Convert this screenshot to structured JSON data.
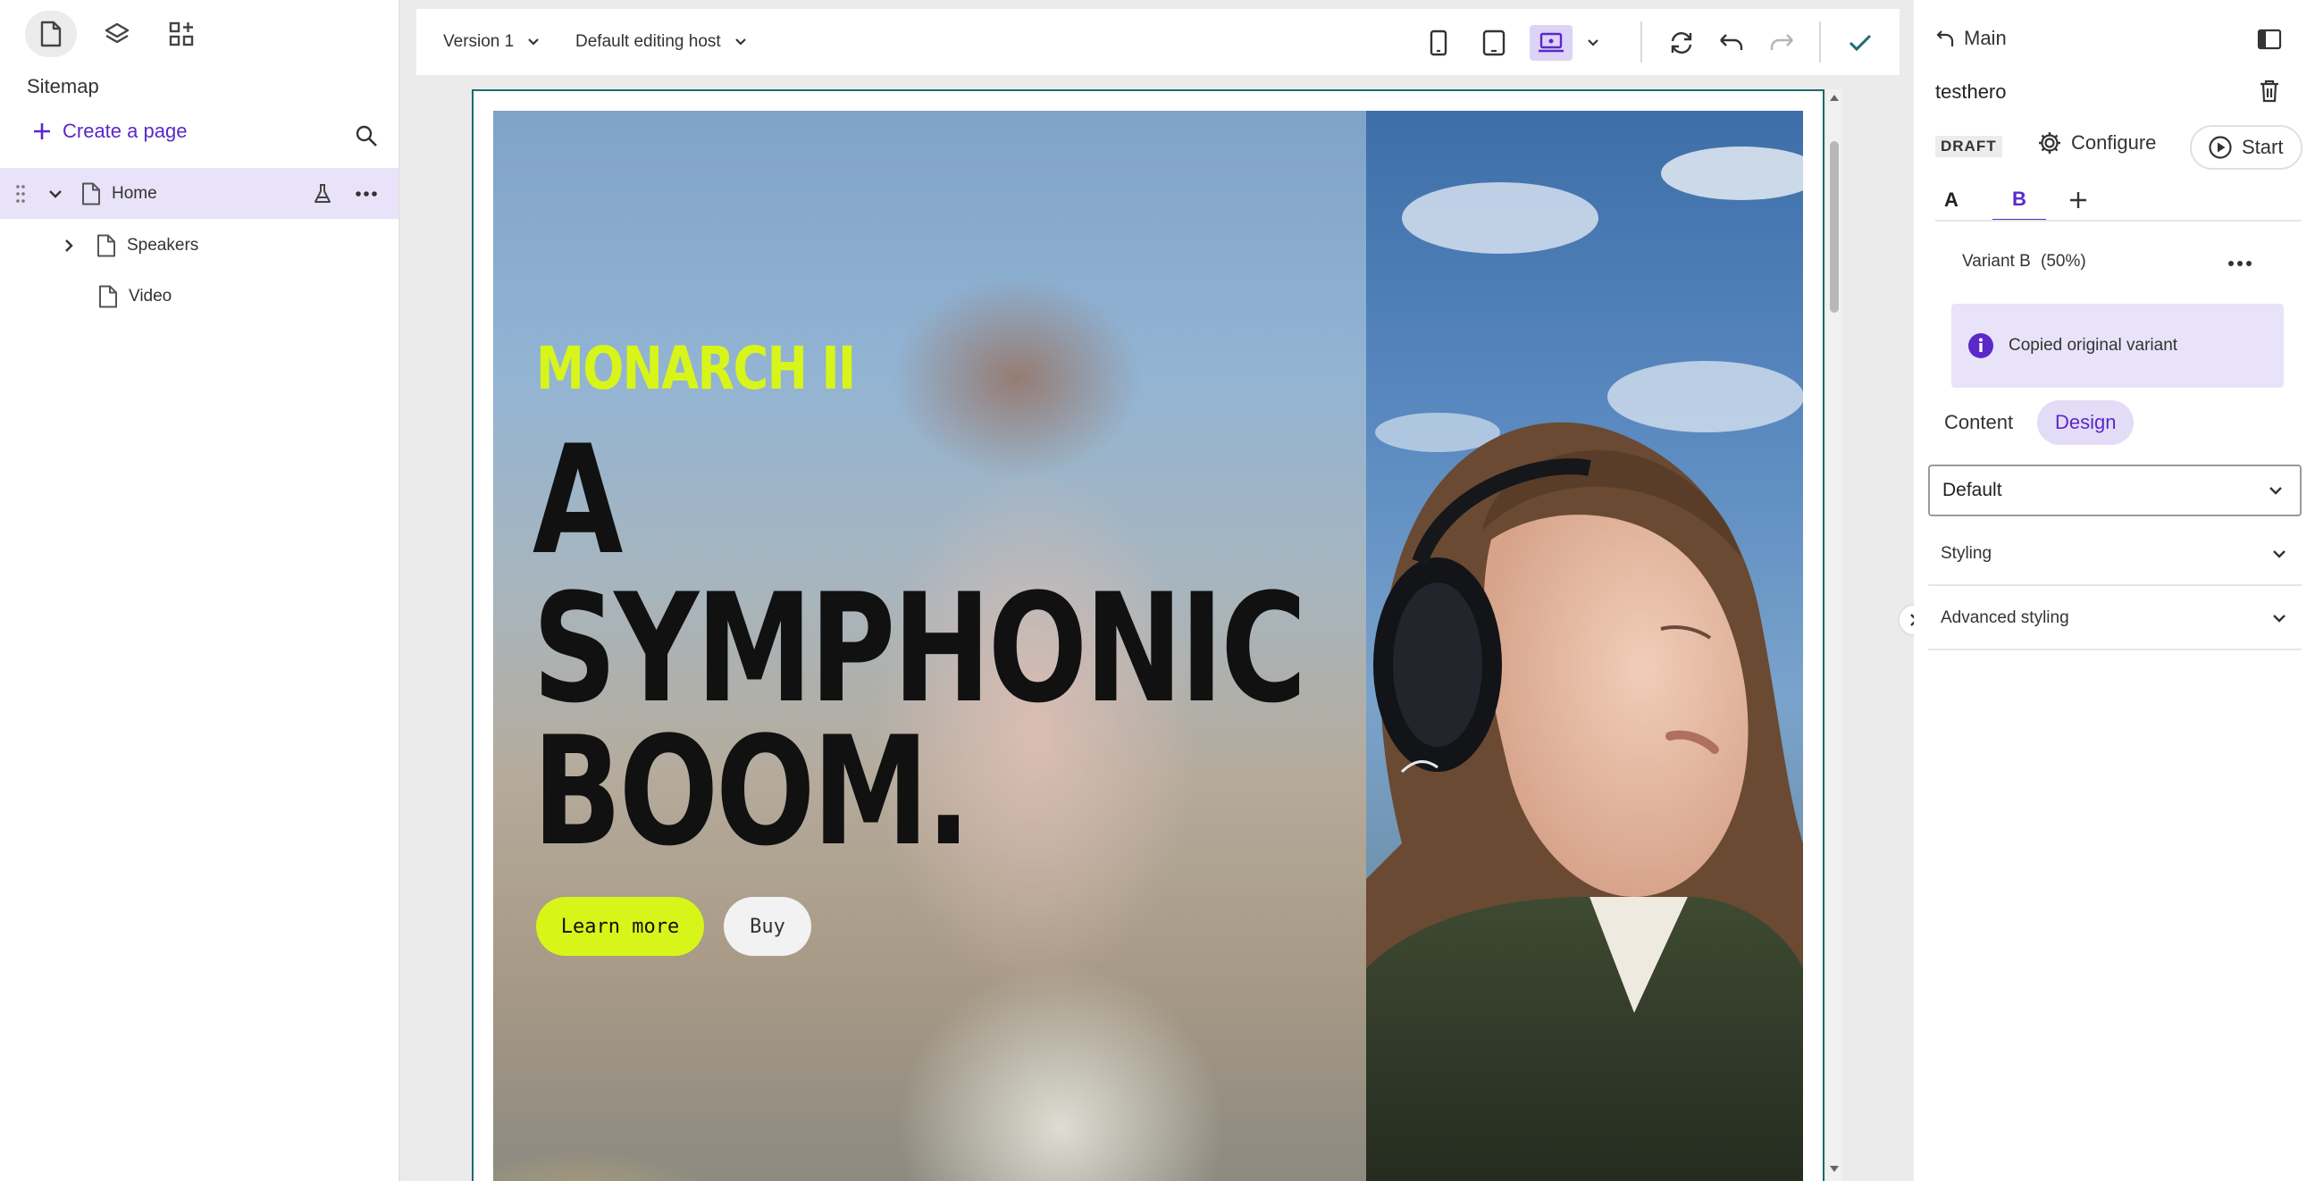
{
  "left_sidebar": {
    "title": "Sitemap",
    "create_page_label": "Create a page",
    "tree": [
      {
        "label": "Home",
        "expanded": true,
        "selected": true
      },
      {
        "label": "Speakers",
        "expanded": false
      },
      {
        "label": "Video"
      }
    ]
  },
  "toolbar": {
    "version_label": "Version 1",
    "editing_host_label": "Default editing host"
  },
  "hero": {
    "eyebrow": "MONARCH II",
    "headline_line1": "A",
    "headline_line2": "SYMPHONIC",
    "headline_line3": "BOOM.",
    "primary_button": "Learn more",
    "secondary_button": "Buy",
    "accent_color": "#d8f51a"
  },
  "right_panel": {
    "back_label": "Main",
    "component_name": "testhero",
    "status_badge": "DRAFT",
    "configure_label": "Configure",
    "start_label": "Start",
    "variant_tabs": [
      "A",
      "B"
    ],
    "active_variant_tab": "B",
    "variant_name": "Variant B",
    "variant_split": "(50%)",
    "info_message": "Copied original variant",
    "segments": [
      "Content",
      "Design"
    ],
    "active_segment": "Design",
    "select_value": "Default",
    "accordions": [
      "Styling",
      "Advanced styling"
    ],
    "accent_color": "#5b28c9"
  }
}
